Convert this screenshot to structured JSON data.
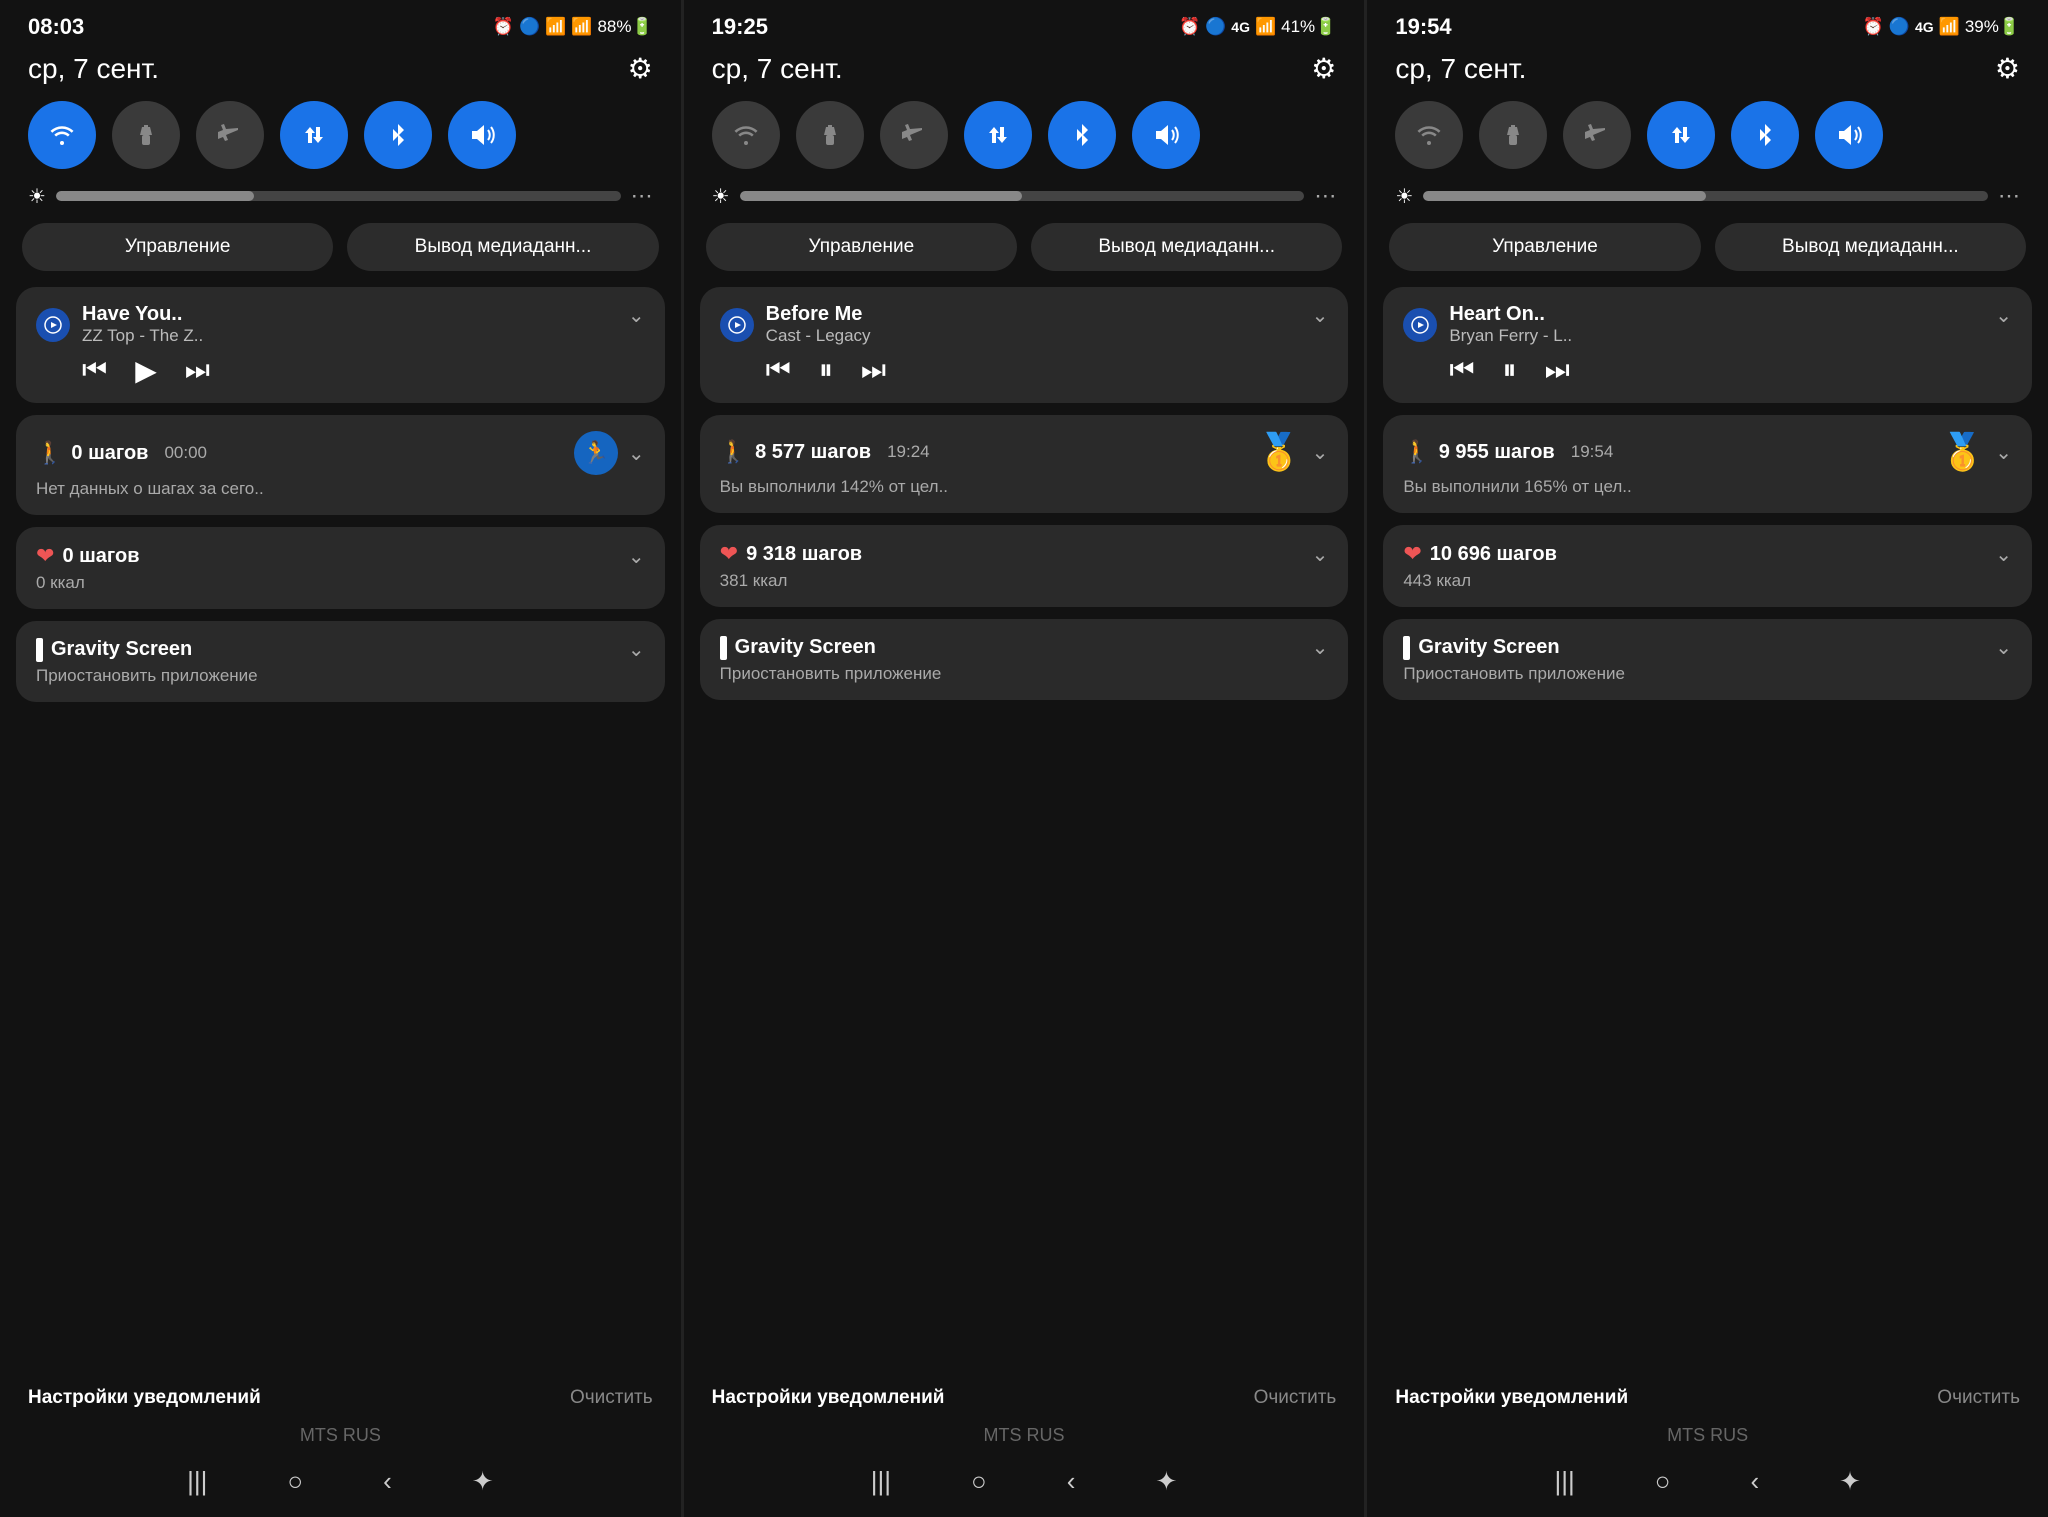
{
  "panels": [
    {
      "id": "panel1",
      "status": {
        "time": "08:03",
        "icons": "🔔 🔵 📶 88%🔋"
      },
      "date": "ср, 7 сент.",
      "brightness_pct": 35,
      "tabs": [
        "Управление",
        "Вывод медиаданн..."
      ],
      "toggles": [
        {
          "id": "wifi",
          "active": true,
          "symbol": "📶"
        },
        {
          "id": "torch",
          "active": false,
          "symbol": "🔦"
        },
        {
          "id": "airplane",
          "active": false,
          "symbol": "✈"
        },
        {
          "id": "data",
          "active": true,
          "symbol": "⇅"
        },
        {
          "id": "bluetooth",
          "active": true,
          "symbol": "🔵"
        },
        {
          "id": "volume",
          "active": true,
          "symbol": "🔊"
        }
      ],
      "media": {
        "title": "Have You..",
        "subtitle": "ZZ Top - The Z..",
        "playing": false
      },
      "steps1": {
        "count": "0 шагов",
        "time": "00:00",
        "desc": "Нет данных о шагах за сего..",
        "badge": false
      },
      "steps2": {
        "count": "0 шагов",
        "kcal": "0 ккал"
      },
      "gravity": {
        "title": "Gravity Screen",
        "sub": "Приостановить приложение"
      },
      "notif_settings": "Настройки уведомлений",
      "notif_clear": "Очистить",
      "carrier": "MTS RUS"
    },
    {
      "id": "panel2",
      "status": {
        "time": "19:25",
        "icons": "🔔 🔵 4G 📶 41%🔋"
      },
      "date": "ср, 7 сент.",
      "brightness_pct": 50,
      "tabs": [
        "Управление",
        "Вывод медиаданн..."
      ],
      "toggles": [
        {
          "id": "wifi",
          "active": false,
          "symbol": "📶"
        },
        {
          "id": "torch",
          "active": false,
          "symbol": "🔦"
        },
        {
          "id": "airplane",
          "active": false,
          "symbol": "✈"
        },
        {
          "id": "data",
          "active": true,
          "symbol": "⇅"
        },
        {
          "id": "bluetooth",
          "active": true,
          "symbol": "🔵"
        },
        {
          "id": "volume",
          "active": true,
          "symbol": "🔊"
        }
      ],
      "media": {
        "title": "Before Me",
        "subtitle": "Cast - Legacy",
        "playing": true
      },
      "steps1": {
        "count": "8 577 шагов",
        "time": "19:24",
        "desc": "Вы выполнили 142% от цел..",
        "badge": true,
        "badge_emoji": "🥇"
      },
      "steps2": {
        "count": "9 318 шагов",
        "kcal": "381 ккал"
      },
      "gravity": {
        "title": "Gravity Screen",
        "sub": "Приостановить приложение"
      },
      "notif_settings": "Настройки уведомлений",
      "notif_clear": "Очистить",
      "carrier": "MTS RUS"
    },
    {
      "id": "panel3",
      "status": {
        "time": "19:54",
        "icons": "🔔 🔵 4G 📶 39%🔋"
      },
      "date": "ср, 7 сент.",
      "brightness_pct": 50,
      "tabs": [
        "Управление",
        "Вывод медиаданн..."
      ],
      "toggles": [
        {
          "id": "wifi",
          "active": false,
          "symbol": "📶"
        },
        {
          "id": "torch",
          "active": false,
          "symbol": "🔦"
        },
        {
          "id": "airplane",
          "active": false,
          "symbol": "✈"
        },
        {
          "id": "data",
          "active": true,
          "symbol": "⇅"
        },
        {
          "id": "bluetooth",
          "active": true,
          "symbol": "🔵"
        },
        {
          "id": "volume",
          "active": true,
          "symbol": "🔊"
        }
      ],
      "media": {
        "title": "Heart On..",
        "subtitle": "Bryan Ferry - L..",
        "playing": true
      },
      "steps1": {
        "count": "9 955 шагов",
        "time": "19:54",
        "desc": "Вы выполнили 165% от цел..",
        "badge": true,
        "badge_emoji": "🥇"
      },
      "steps2": {
        "count": "10 696 шагов",
        "kcal": "443 ккал"
      },
      "gravity": {
        "title": "Gravity Screen",
        "sub": "Приостановить приложение"
      },
      "notif_settings": "Настройки уведомлений",
      "notif_clear": "Очистить",
      "carrier": "MTS RUS"
    }
  ]
}
